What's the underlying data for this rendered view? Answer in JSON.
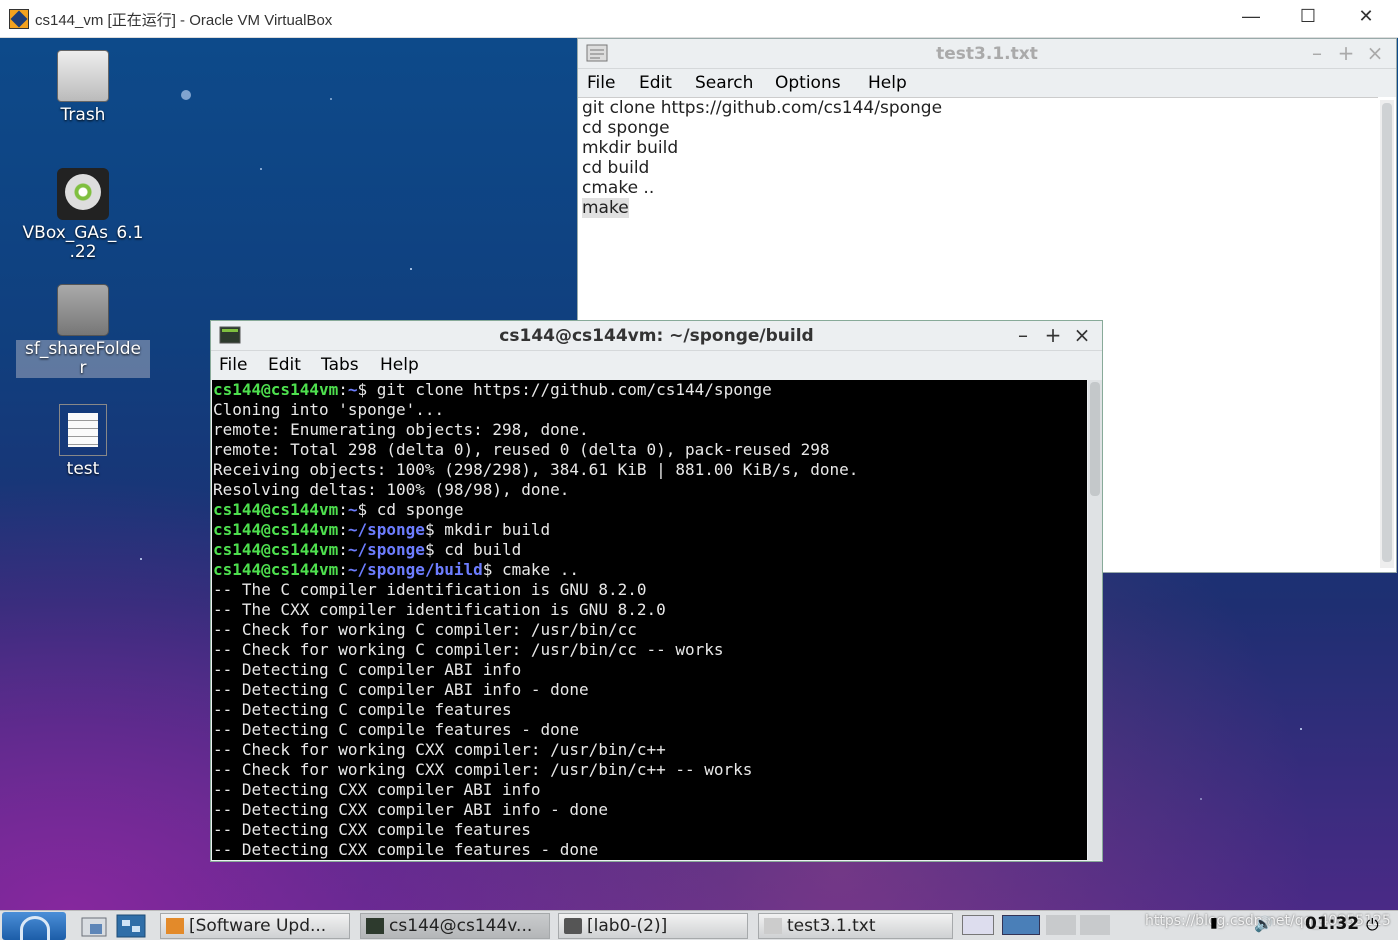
{
  "host": {
    "title": "cs144_vm [正在运行] - Oracle VM VirtualBox",
    "minimize": "—",
    "maximize": "☐",
    "close": "✕"
  },
  "desktop_icons": [
    {
      "label": "Trash",
      "icon": "trash-icon"
    },
    {
      "label": "VBox_GAs_6.1\n.22",
      "icon": "cdrom-icon"
    },
    {
      "label": "sf_shareFolde\nr",
      "icon": "harddisk-icon"
    },
    {
      "label": "test",
      "icon": "text-file-icon"
    }
  ],
  "leafpad": {
    "title": "test3.1.txt",
    "menu": [
      "File",
      "Edit",
      "Search",
      "Options",
      "Help"
    ],
    "lines": [
      "git clone https://github.com/cs144/sponge",
      "cd sponge",
      "mkdir build",
      "cd build",
      "cmake ..",
      "make"
    ],
    "buttons": {
      "min": "–",
      "max": "+",
      "close": "×"
    }
  },
  "terminal": {
    "title": "cs144@cs144vm: ~/sponge/build",
    "menu": [
      "File",
      "Edit",
      "Tabs",
      "Help"
    ],
    "buttons": {
      "min": "–",
      "max": "+",
      "close": "×"
    },
    "lines": [
      {
        "u": "cs144@cs144vm",
        "p": "~",
        "c": "$ git clone https://github.com/cs144/sponge"
      },
      {
        "t": "Cloning into 'sponge'..."
      },
      {
        "t": "remote: Enumerating objects: 298, done."
      },
      {
        "t": "remote: Total 298 (delta 0), reused 0 (delta 0), pack-reused 298"
      },
      {
        "t": "Receiving objects: 100% (298/298), 384.61 KiB | 881.00 KiB/s, done."
      },
      {
        "t": "Resolving deltas: 100% (98/98), done."
      },
      {
        "u": "cs144@cs144vm",
        "p": "~",
        "c": "$ cd sponge"
      },
      {
        "u": "cs144@cs144vm",
        "p": "~/sponge",
        "c": "$ mkdir build"
      },
      {
        "u": "cs144@cs144vm",
        "p": "~/sponge",
        "c": "$ cd build"
      },
      {
        "u": "cs144@cs144vm",
        "p": "~/sponge/build",
        "c": "$ cmake .."
      },
      {
        "t": "-- The C compiler identification is GNU 8.2.0"
      },
      {
        "t": "-- The CXX compiler identification is GNU 8.2.0"
      },
      {
        "t": "-- Check for working C compiler: /usr/bin/cc"
      },
      {
        "t": "-- Check for working C compiler: /usr/bin/cc -- works"
      },
      {
        "t": "-- Detecting C compiler ABI info"
      },
      {
        "t": "-- Detecting C compiler ABI info - done"
      },
      {
        "t": "-- Detecting C compile features"
      },
      {
        "t": "-- Detecting C compile features - done"
      },
      {
        "t": "-- Check for working CXX compiler: /usr/bin/c++"
      },
      {
        "t": "-- Check for working CXX compiler: /usr/bin/c++ -- works"
      },
      {
        "t": "-- Detecting CXX compiler ABI info"
      },
      {
        "t": "-- Detecting CXX compiler ABI info - done"
      },
      {
        "t": "-- Detecting CXX compile features"
      },
      {
        "t": "-- Detecting CXX compile features - done"
      }
    ]
  },
  "taskbar": {
    "tasks": [
      "[Software Upd...",
      "cs144@cs144v...",
      "[lab0-(2)]",
      "test3.1.txt"
    ],
    "watermark": "https://blog.csdn.net/qq_40855125",
    "clock": "01:32"
  }
}
